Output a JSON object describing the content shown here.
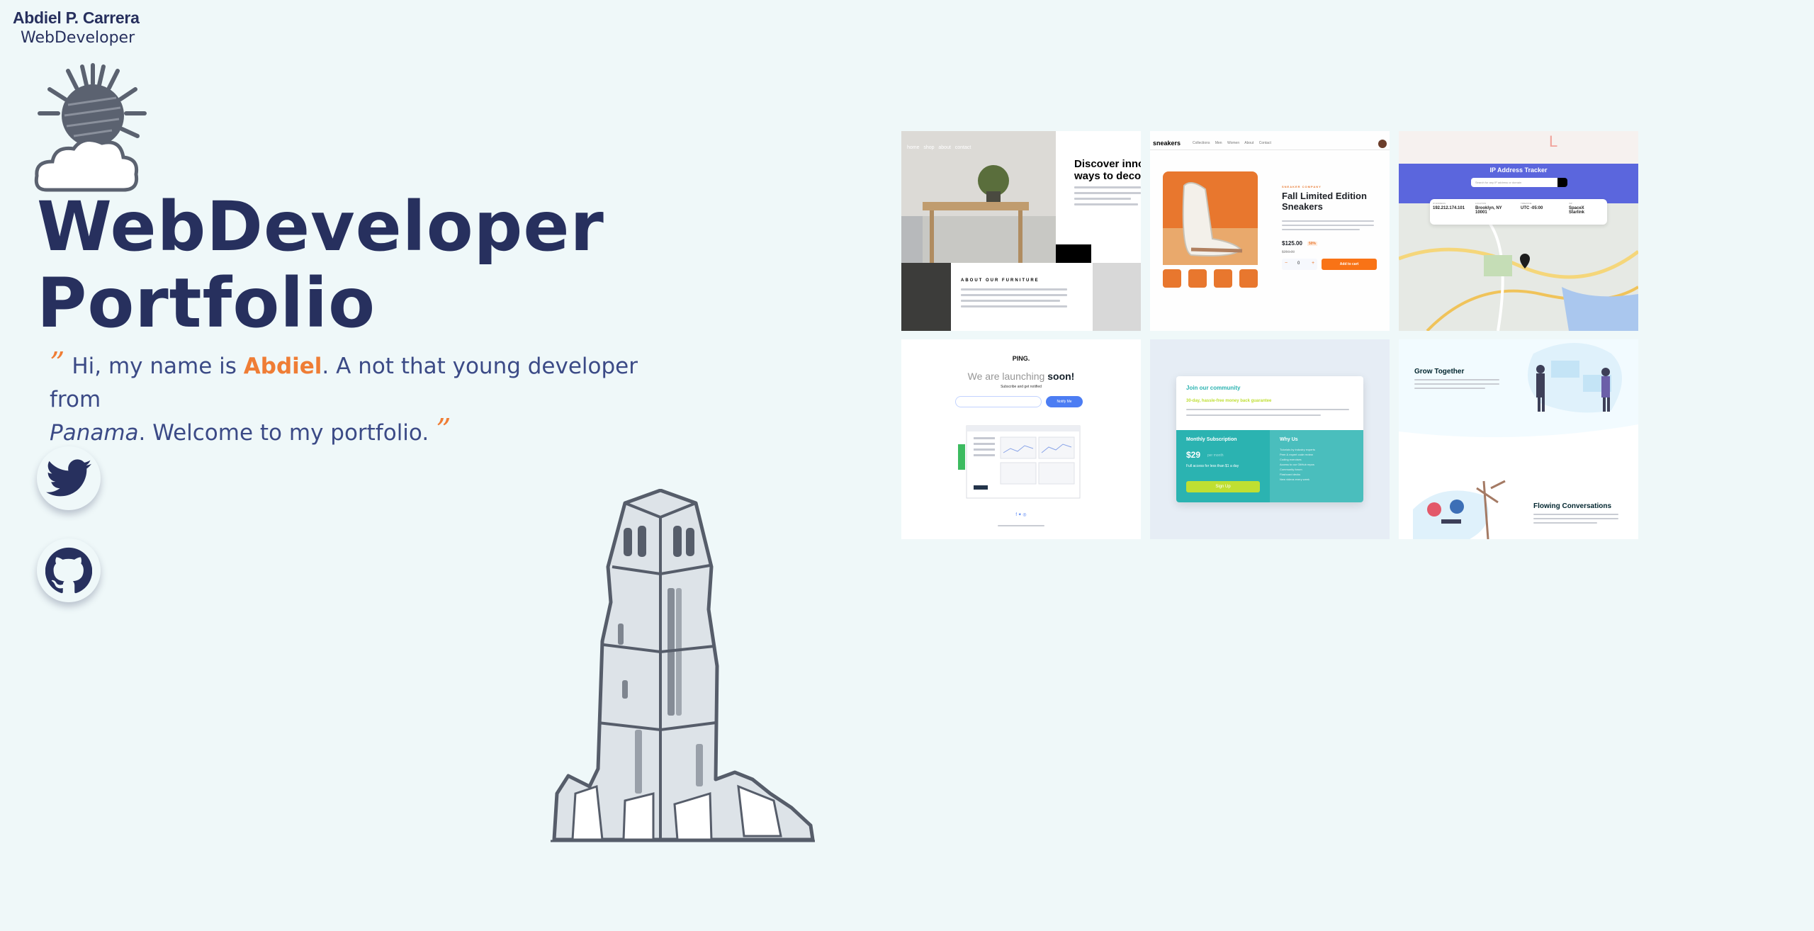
{
  "header": {
    "name": "Abdiel P. Carrera",
    "role": "WebDeveloper"
  },
  "hero": {
    "line1": "WebDeveloper",
    "line2": "Portfolio"
  },
  "intro": {
    "open_quote": "”",
    "text_a": "Hi, my name is ",
    "name": "Abdiel",
    "text_b": ". A not that young developer from ",
    "place": "Panama",
    "text_c": ". Welcome to my portfolio.",
    "close_quote": "”"
  },
  "social": {
    "twitter_icon": "twitter-icon",
    "github_icon": "github-icon"
  },
  "projects": [
    {
      "id": "room-homepage",
      "nav": [
        "home",
        "shop",
        "about",
        "contact"
      ],
      "title_1": "Discover innov",
      "title_2": "ways to decor",
      "section": "ABOUT OUR FURNITURE"
    },
    {
      "id": "sneakers",
      "brand": "sneakers",
      "nav": [
        "Collections",
        "Men",
        "Women",
        "About",
        "Contact"
      ],
      "company": "SNEAKER COMPANY",
      "title_1": "Fall Limited Edition",
      "title_2": "Sneakers",
      "price": "$125.00",
      "discount": "50%",
      "old_price": "$250.00",
      "qty": "0",
      "cta": "Add to cart"
    },
    {
      "id": "ip-tracker",
      "title": "IP Address Tracker",
      "placeholder": "Search for any IP address or domain",
      "labels": [
        "IP ADDRESS",
        "LOCATION",
        "TIMEZONE",
        "ISP"
      ],
      "values": [
        "192.212.174.101",
        "Brooklyn, NY 10001",
        "UTC -05:00",
        "SpaceX Starlink"
      ]
    },
    {
      "id": "ping",
      "brand": "PING.",
      "title_a": "We are launching ",
      "title_b": "soon!",
      "sub": "Subscribe and get notified",
      "button": "Notify Me"
    },
    {
      "id": "single-price",
      "title": "Join our community",
      "guarantee": "30-day, hassle-free money back guarantee",
      "subscription": "Monthly Subscription",
      "price": "$29",
      "per": "per month",
      "access": "Full access for less than $1 a day",
      "signup": "Sign Up",
      "why": "Why Us",
      "reasons": [
        "Tutorials by industry experts",
        "Peer & expert code review",
        "Coding exercises",
        "Access to our GitHub repos",
        "Community forum",
        "Flashcard decks",
        "New videos every week"
      ]
    },
    {
      "id": "huddle",
      "title_1": "Grow Together",
      "title_2": "Flowing Conversations"
    }
  ],
  "colors": {
    "background": "#eff8f9",
    "navy": "#27305e",
    "accent": "#ef7d35"
  }
}
